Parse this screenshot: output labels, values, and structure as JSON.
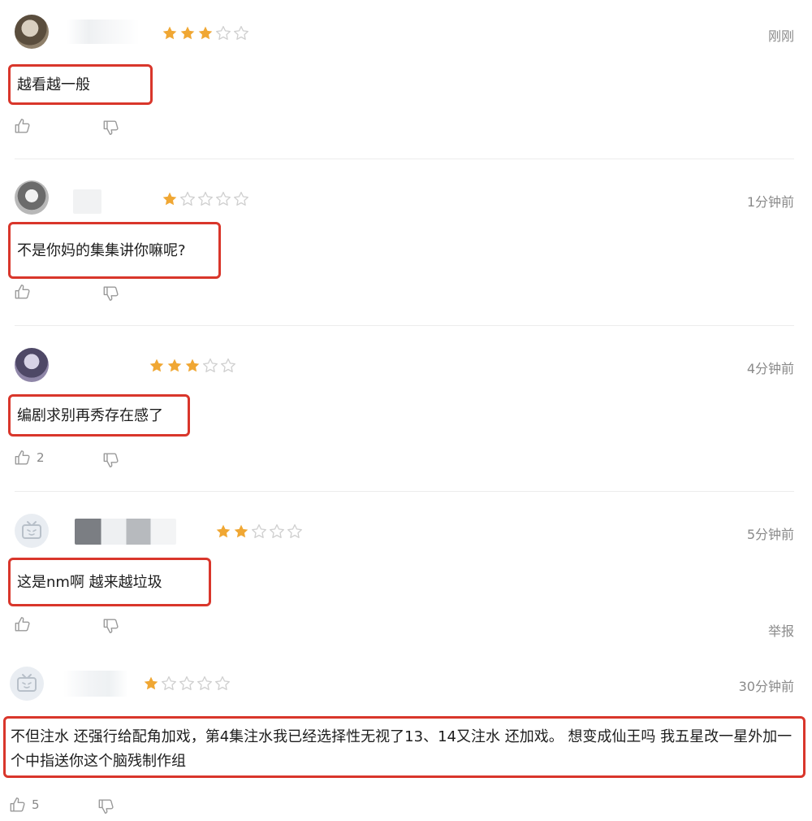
{
  "reviews": [
    {
      "rating": 3,
      "time": "刚刚",
      "content": "越看越一般",
      "likes": "",
      "report": ""
    },
    {
      "rating": 1,
      "time": "1分钟前",
      "content": "不是你妈的集集讲你嘛呢?",
      "likes": "",
      "report": ""
    },
    {
      "rating": 3,
      "time": "4分钟前",
      "content": "编剧求别再秀存在感了",
      "likes": "2",
      "report": ""
    },
    {
      "rating": 2,
      "time": "5分钟前",
      "content": "这是nm啊 越来越垃圾",
      "likes": "",
      "report": "举报"
    },
    {
      "rating": 1,
      "time": "30分钟前",
      "content": "不但注水 还强行给配角加戏，第4集注水我已经选择性无视了13、14又注水 还加戏。 想变成仙王吗 我五星改一星外加一个中指送你这个脑残制作组",
      "likes": "5",
      "report": ""
    }
  ],
  "max_rating": 5,
  "colors": {
    "star_on": "#f0a733",
    "star_off": "#cfcfcf",
    "highlight": "#d9362b"
  },
  "icons": {
    "like": "thumb-up-icon",
    "dislike": "thumb-down-icon",
    "star": "star-icon",
    "avatar": "tv-avatar-icon"
  }
}
